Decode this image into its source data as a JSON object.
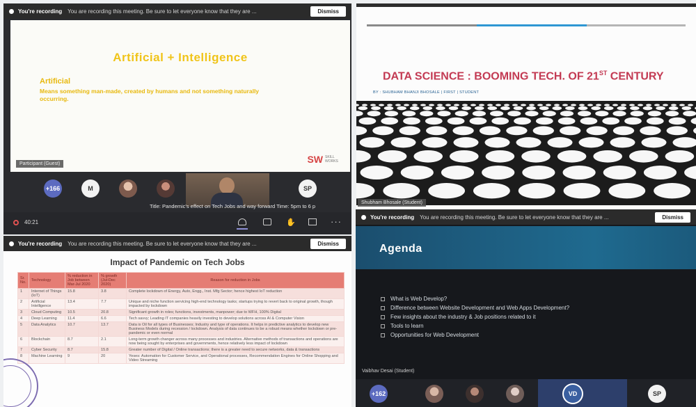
{
  "recording": {
    "title": "You're recording",
    "message": "You are recording this meeting. Be sure to let everyone know that they are ...",
    "dismiss": "Dismiss"
  },
  "p1": {
    "slide_title": "Artificial + Intelligence",
    "term": "Artificial",
    "definition": "Means something man-made, created by humans and not something naturally occurring.",
    "logo": "SW",
    "logo_tagline": "SKILL WORKS",
    "name_tag": "Participant (Guest)",
    "participants": [
      {
        "initials": "+166",
        "color": "#5c6bc0"
      },
      {
        "initials": "M",
        "color": "#f2f2f2"
      },
      {
        "initials": "",
        "color": "#c49a82"
      },
      {
        "initials": "",
        "color": "#7b5a52"
      },
      {
        "initials": "SP",
        "color": "#f2f2f2"
      }
    ],
    "ticker": "Title: Pandemic's effect on Tech Jobs and way forward Time: 5pm to 6 p"
  },
  "toolbar": {
    "timer": "40:21"
  },
  "p2": {
    "title": "DATA SCIENCE : BOOMING TECH. OF 21",
    "title_sup": "ST",
    "title_end": " CENTURY",
    "subtitle": "BY : SHUBHAM BHANJI BHOSALE | FIRST | STUDENT",
    "name_tag": "Shubham Bhosale (Student)"
  },
  "p3": {
    "title": "Impact of Pandemic on Tech Jobs",
    "headers": [
      "Sr. No.",
      "Technology",
      "% reduction in Job between Mar-Jul 2020",
      "% growth (Jul-Dec 2020)",
      "Reason for reduction in Jobs"
    ],
    "rows": [
      [
        "1",
        "Internet of Things (IoT)",
        "15.8",
        "3.8",
        "Complete lockdown of Energy, Auto, Engg., Inst. Mfg Sector; hence highest IoT reduction"
      ],
      [
        "2",
        "Artificial Intelligence",
        "13.4",
        "7.7",
        "Unique and niche function servicing high-end technology tasks; startups trying to revert back to original growth, though impacted by lockdown"
      ],
      [
        "3",
        "Cloud Computing",
        "10.5",
        "20.8",
        "Significant growth in roles; functions, investments, manpower; due to WFH, 100% Digital"
      ],
      [
        "4",
        "Deep Learning",
        "11.4",
        "6.6",
        "Tech savvy; Leading IT companies heavily investing to develop solutions across AI & Computer Vision"
      ],
      [
        "5",
        "Data Analytics",
        "10.7",
        "13.7",
        "Data is Oil for all types of Businesses; Industry and type of operations. It helps in predictive analytics to develop new Business Models during recession / lockdown. Analysis of data continues to be a robust means whether lockdown or pre-pandemic or even normal"
      ],
      [
        "6",
        "Blockchain",
        "8.7",
        "2.1",
        "Long-term growth changer across many processes and industries. Alternative methods of transactions and operations are now being sought by enterprises and governments, hence relatively less impact of lockdown"
      ],
      [
        "7",
        "Cyber Security",
        "8.7",
        "15.8",
        "Greater number of Digital / Online transactions; there is a greater need to secure networks, data & transactions"
      ],
      [
        "8",
        "Machine Learning",
        "9",
        "20",
        "Yeses: Automation for Customer Service, and Operational processes, Recommendation Engines for Online Shopping and Video Streaming"
      ]
    ]
  },
  "p4": {
    "title": "Agenda",
    "items": [
      "What is Web Develop?",
      "Difference between Website Development and Web Apps Development?",
      "Few insights about the industry & Job positions related to it",
      "Tools to learn",
      "Opportunities for Web Development"
    ],
    "name_tag": "Vaibhav Desai (Student)",
    "participants": [
      {
        "initials": "+162",
        "color": "#5c6bc0"
      },
      {
        "initials": "",
        "color": "#9a7d70"
      },
      {
        "initials": "",
        "color": "#5a4a48"
      },
      {
        "initials": "",
        "color": "#a38b86"
      },
      {
        "initials": "VD",
        "color": "#3a5fa0"
      },
      {
        "initials": "SP",
        "color": "#f2f2f2"
      }
    ]
  }
}
